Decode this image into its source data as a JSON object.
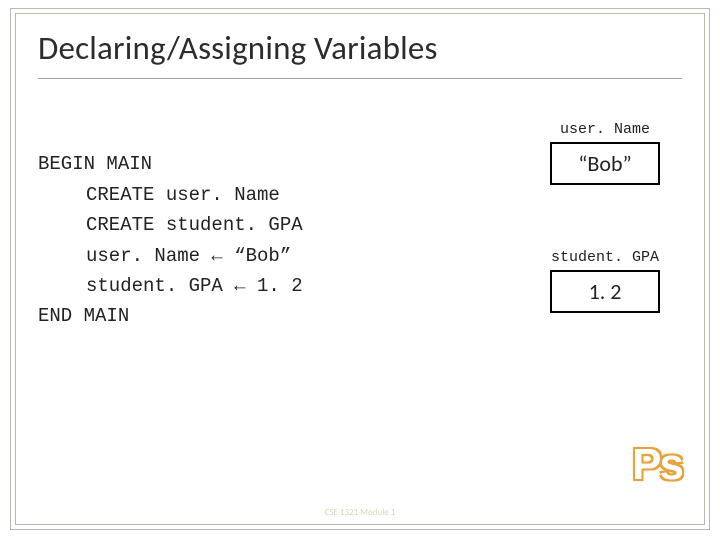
{
  "title": "Declaring/Assigning Variables",
  "code": {
    "l1": "BEGIN MAIN",
    "l2": "CREATE user. Name",
    "l3": "CREATE student. GPA",
    "l4": "user. Name ← “Bob”",
    "l5": "student. GPA ← 1. 2",
    "l6": "END MAIN"
  },
  "vars": {
    "name_label": "user. Name",
    "name_value": "“Bob”",
    "gpa_label": "student. GPA",
    "gpa_value": "1. 2"
  },
  "logo": "Ps",
  "footer": {
    "left": "",
    "center": "CSE 1321 Module 1",
    "right": ""
  }
}
